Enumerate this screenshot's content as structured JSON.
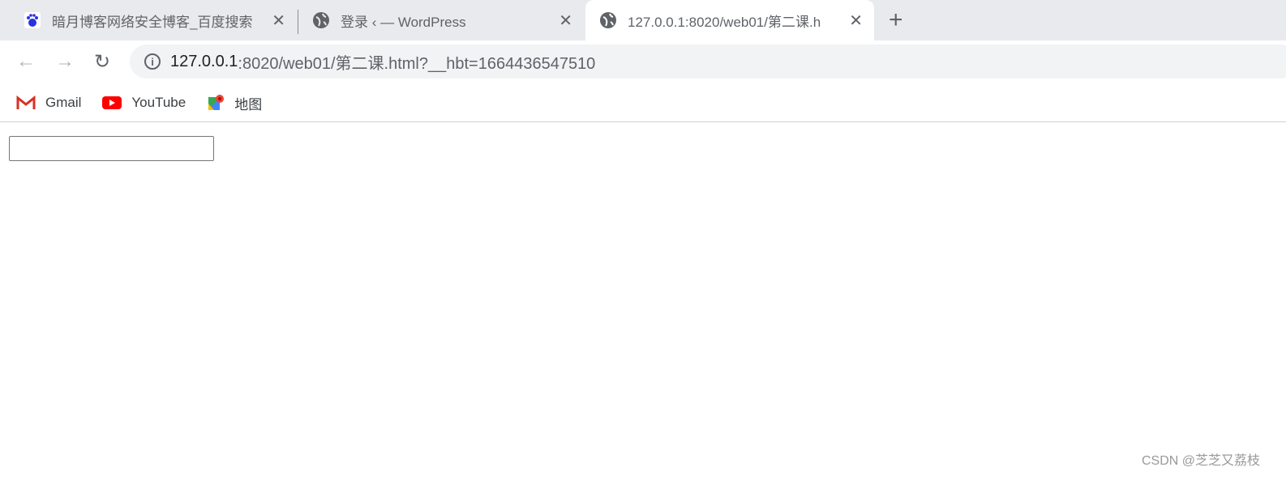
{
  "tabs": [
    {
      "title": "暗月博客网络安全博客_百度搜索",
      "icon": "baidu-icon"
    },
    {
      "title": "登录 ‹ — WordPress",
      "icon": "globe-icon"
    },
    {
      "title": "127.0.0.1:8020/web01/第二课.h",
      "icon": "globe-icon",
      "active": true
    }
  ],
  "address": {
    "host": "127.0.0.1",
    "rest": ":8020/web01/第二课.html?__hbt=1664436547510"
  },
  "bookmarks": [
    {
      "label": "Gmail"
    },
    {
      "label": "YouTube"
    },
    {
      "label": "地图"
    }
  ],
  "page": {
    "input_value": ""
  },
  "watermark": "CSDN @芝芝又荔枝"
}
